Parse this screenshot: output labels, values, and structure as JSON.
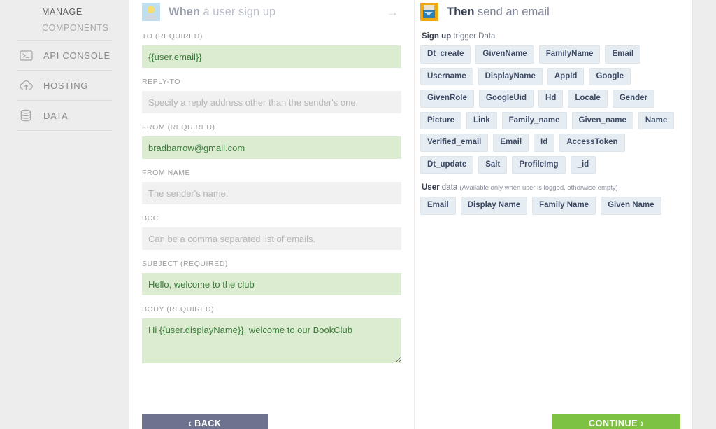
{
  "sidebar": {
    "heading": "MANAGE",
    "subheading": "COMPONENTS",
    "items": [
      {
        "label": "API CONSOLE",
        "icon": "terminal-icon"
      },
      {
        "label": "HOSTING",
        "icon": "cloud-upload-icon"
      },
      {
        "label": "DATA",
        "icon": "database-icon"
      }
    ]
  },
  "trigger_panel": {
    "icon": "user-signup-icon",
    "prefix": "When",
    "text": " a user sign up",
    "arrow": "→"
  },
  "action_panel": {
    "icon": "send-email-icon",
    "prefix": "Then",
    "text": " send an email"
  },
  "form": {
    "fields": [
      {
        "label": "TO (REQUIRED)",
        "value": "{{user.email}}",
        "placeholder": "",
        "state": "filled",
        "name": "to-field"
      },
      {
        "label": "REPLY-TO",
        "value": "",
        "placeholder": "Specify a reply address other than the sender's one.",
        "state": "empty",
        "name": "reply-to-field"
      },
      {
        "label": "FROM (REQUIRED)",
        "value": "bradbarrow@gmail.com",
        "placeholder": "",
        "state": "filled",
        "name": "from-field"
      },
      {
        "label": "FROM NAME",
        "value": "",
        "placeholder": "The sender's name.",
        "state": "empty",
        "name": "from-name-field"
      },
      {
        "label": "BCC",
        "value": "",
        "placeholder": "Can be a comma separated list of emails.",
        "state": "empty",
        "name": "bcc-field"
      },
      {
        "label": "SUBJECT (REQUIRED)",
        "value": "Hello, welcome to the club",
        "placeholder": "",
        "state": "filled",
        "name": "subject-field"
      }
    ],
    "body": {
      "label": "BODY (REQUIRED)",
      "value": "Hi {{user.displayName}}, welcome to our BookClub",
      "name": "body-field"
    }
  },
  "trigger_data": {
    "caption_bold": "Sign up",
    "caption_rest": " trigger Data",
    "rows": [
      [
        "Dt_create",
        "GivenName",
        "FamilyName",
        "Email",
        "Username"
      ],
      [
        "DisplayName",
        "AppId",
        "Google",
        "GivenRole",
        "GoogleUid",
        "Hd"
      ],
      [
        "Locale",
        "Gender",
        "Picture",
        "Link",
        "Family_name",
        "Given_name"
      ],
      [
        "Name",
        "Verified_email",
        "Email",
        "Id",
        "AccessToken",
        "Dt_update"
      ],
      [
        "Salt",
        "ProfileImg",
        "_id"
      ]
    ]
  },
  "user_data": {
    "caption_bold": "User",
    "caption_rest": " data ",
    "caption_note": "(Available only when user is logged, otherwise empty)",
    "tags": [
      "Email",
      "Display Name",
      "Family Name",
      "Given Name"
    ]
  },
  "footer": {
    "back_label": "‹ BACK",
    "continue_label": "CONTINUE ›"
  },
  "colors": {
    "accent_green": "#7dc242",
    "back_button": "#6d738f",
    "filled_field_bg": "#dcecd1",
    "filled_field_text": "#3b7b3b",
    "tag_bg": "#e6edf2",
    "tag_text": "#3d4a66"
  }
}
